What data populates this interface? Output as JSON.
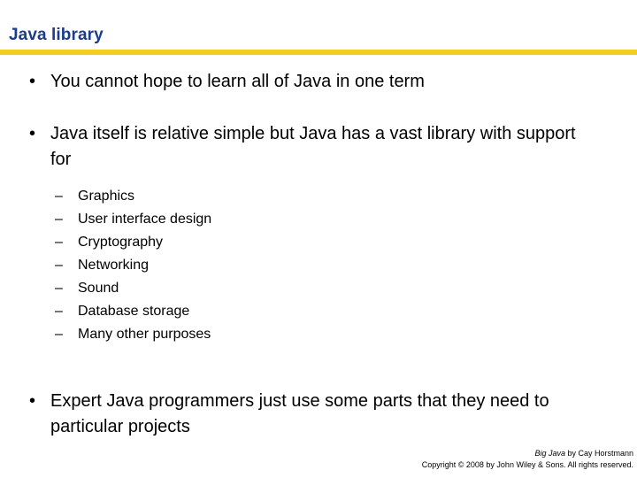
{
  "slide": {
    "title": "Java library",
    "accent_rule_color": "#f5cd21",
    "title_color": "#1c3b8e",
    "background_color": "#ffffff",
    "bullet_marker": "•",
    "sub_marker": "–"
  },
  "content": {
    "bullets": [
      {
        "text": "You cannot hope to learn all of Java in one term"
      },
      {
        "text": "Java itself is relative simple but Java has a vast library with support for"
      },
      {
        "text": "Expert Java programmers just use some parts that they need to particular projects"
      }
    ],
    "sub_items": [
      {
        "label": "Graphics"
      },
      {
        "label": "User interface design"
      },
      {
        "label": "Cryptography"
      },
      {
        "label": "Networking"
      },
      {
        "label": "Sound"
      },
      {
        "label": "Database storage"
      },
      {
        "label": "Many other purposes"
      }
    ]
  },
  "footer": {
    "book_title": "Big Java",
    "attribution": " by Cay Horstmann",
    "copyright": "Copyright © 2008 by John Wiley & Sons.  All rights reserved."
  }
}
